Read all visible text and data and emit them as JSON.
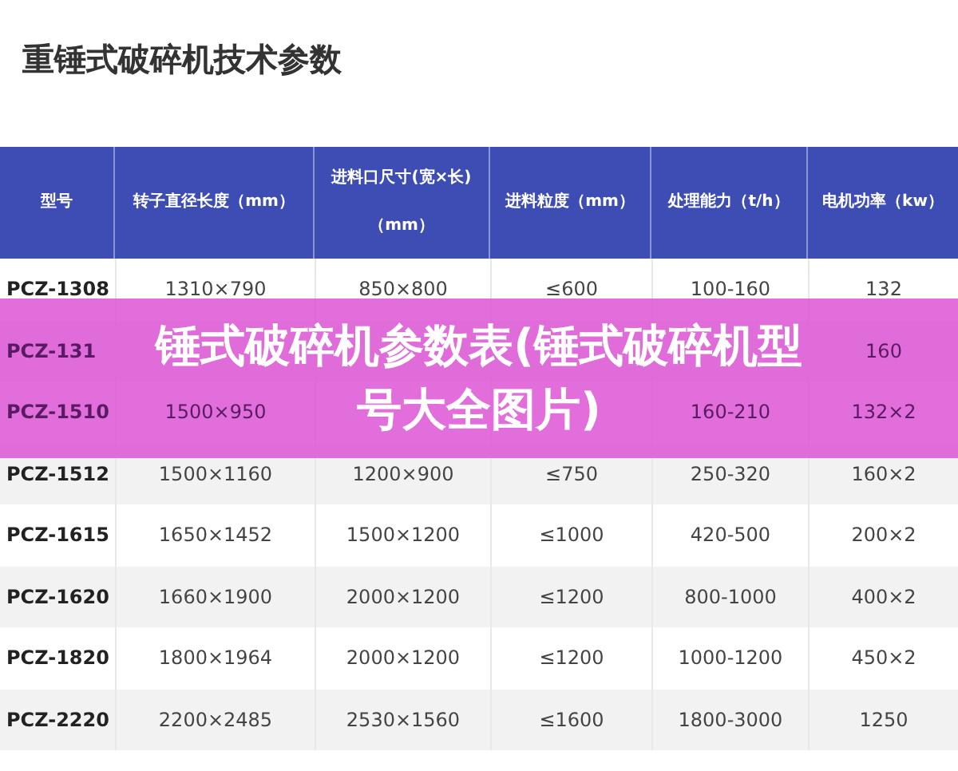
{
  "heading": "重锤式破碎机技术参数",
  "table": {
    "columns": [
      "型号",
      "转子直径长度（mm）",
      "进料口尺寸(宽×长)（mm）",
      "进料粒度（mm）",
      "处理能力（t/h）",
      "电机功率（kw）"
    ],
    "rows": [
      [
        "PCZ-1308",
        "1310×790",
        "850×800",
        "≤600",
        "100-160",
        "132"
      ],
      [
        "PCZ-131",
        null,
        null,
        null,
        null,
        "160"
      ],
      [
        "PCZ-1510",
        "1500×950",
        null,
        null,
        "160-210",
        "132×2"
      ],
      [
        "PCZ-1512",
        "1500×1160",
        "1200×900",
        "≤750",
        "250-320",
        "160×2"
      ],
      [
        "PCZ-1615",
        "1650×1452",
        "1500×1200",
        "≤1000",
        "420-500",
        "200×2"
      ],
      [
        "PCZ-1620",
        "1660×1900",
        "2000×1200",
        "≤1200",
        "800-1000",
        "400×2"
      ],
      [
        "PCZ-1820",
        "1800×1964",
        "2000×1200",
        "≤1200",
        "1000-1200",
        "450×2"
      ],
      [
        "PCZ-2220",
        "2200×2485",
        "2530×1560",
        "≤1600",
        "1800-3000",
        "1250"
      ]
    ]
  },
  "banner": {
    "lines": [
      "锤式破碎机参数表(锤式破碎机型",
      "号大全图片)"
    ]
  }
}
